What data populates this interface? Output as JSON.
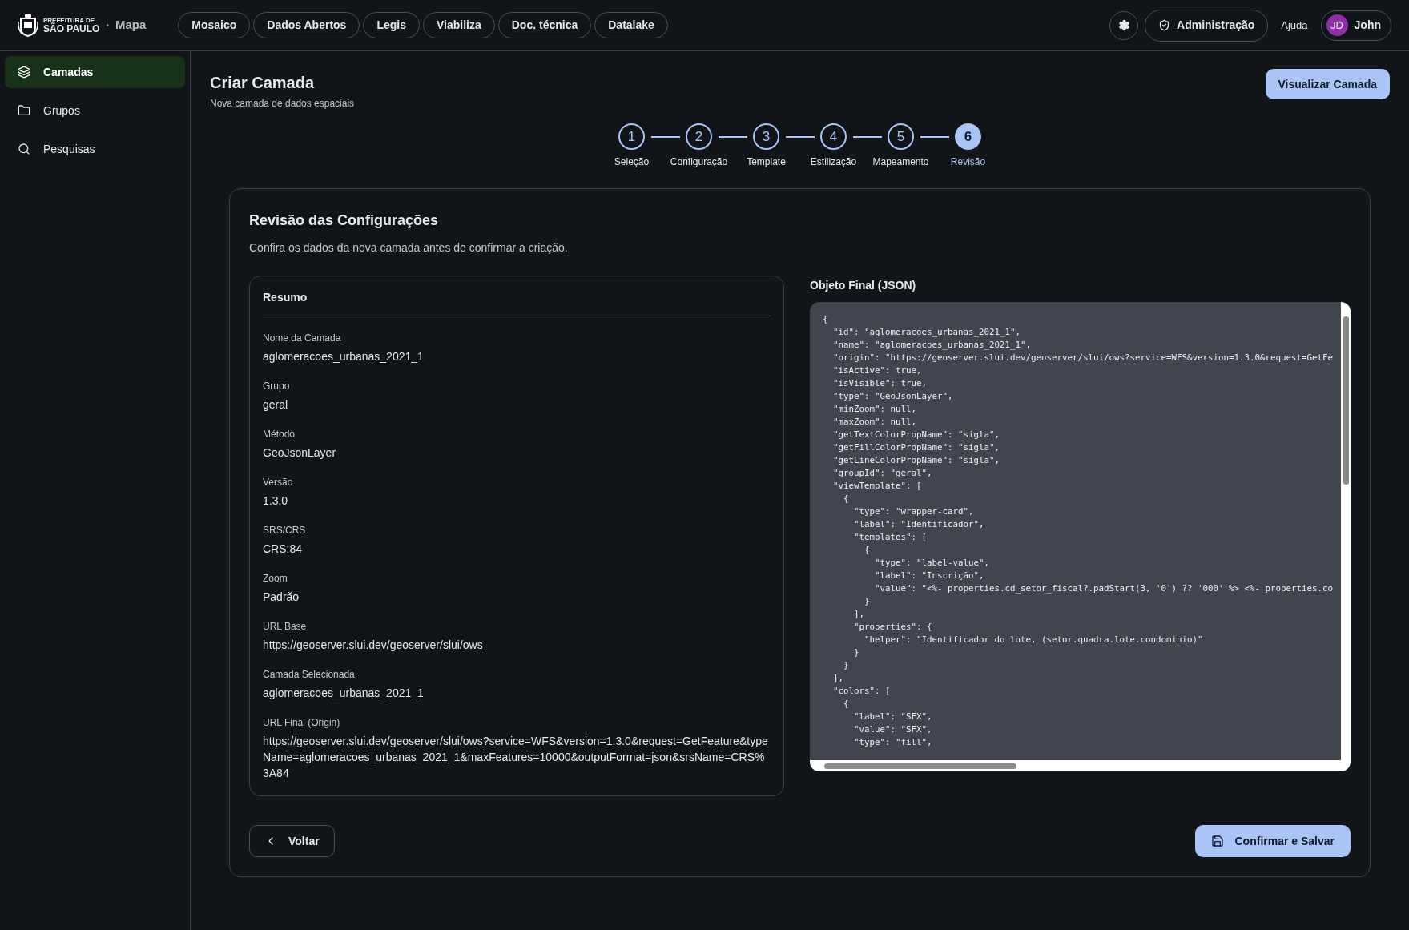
{
  "header": {
    "logo_line1": "PREFEITURA DE",
    "logo_line2": "SÃO PAULO",
    "separator": "•",
    "app_name": "Mapa",
    "nav": [
      "Mosaico",
      "Dados Abertos",
      "Legis",
      "Viabiliza",
      "Doc. técnica",
      "Datalake"
    ],
    "admin_button": "Administração",
    "help_link": "Ajuda",
    "user": {
      "initials": "JD",
      "name": "John"
    }
  },
  "sidebar": {
    "items": [
      {
        "label": "Camadas",
        "selected": true
      },
      {
        "label": "Grupos",
        "selected": false
      },
      {
        "label": "Pesquisas",
        "selected": false
      }
    ]
  },
  "page": {
    "title": "Criar Camada",
    "subtitle": "Nova camada de dados espaciais",
    "preview_button": "Visualizar Camada"
  },
  "steps": [
    {
      "number": "1",
      "label": "Seleção",
      "selected": false
    },
    {
      "number": "2",
      "label": "Configuração",
      "selected": false
    },
    {
      "number": "3",
      "label": "Template",
      "selected": false
    },
    {
      "number": "4",
      "label": "Estilização",
      "selected": false
    },
    {
      "number": "5",
      "label": "Mapeamento",
      "selected": false
    },
    {
      "number": "6",
      "label": "Revisão",
      "selected": true
    }
  ],
  "review": {
    "title": "Revisão das Configurações",
    "description": "Confira os dados da nova camada antes de confirmar a criação.",
    "summary": {
      "title": "Resumo",
      "fields": [
        {
          "label": "Nome da Camada",
          "value": "aglomeracoes_urbanas_2021_1"
        },
        {
          "label": "Grupo",
          "value": "geral"
        },
        {
          "label": "Método",
          "value": "GeoJsonLayer"
        },
        {
          "label": "Versão",
          "value": "1.3.0"
        },
        {
          "label": "SRS/CRS",
          "value": "CRS:84"
        },
        {
          "label": "Zoom",
          "value": "Padrão"
        },
        {
          "label": "URL Base",
          "value": "https://geoserver.slui.dev/geoserver/slui/ows"
        },
        {
          "label": "Camada Selecionada",
          "value": "aglomeracoes_urbanas_2021_1"
        },
        {
          "label": "URL Final (Origin)",
          "value": "https://geoserver.slui.dev/geoserver/slui/ows?service=WFS&version=1.3.0&request=GetFeature&typeName=aglomeracoes_urbanas_2021_1&maxFeatures=10000&outputFormat=json&srsName=CRS%3A84"
        }
      ]
    },
    "json_title": "Objeto Final (JSON)",
    "json_lines": [
      "{",
      "  \"id\": \"aglomeracoes_urbanas_2021_1\",",
      "  \"name\": \"aglomeracoes_urbanas_2021_1\",",
      "  \"origin\": \"https://geoserver.slui.dev/geoserver/slui/ows?service=WFS&version=1.3.0&request=GetFe",
      "  \"isActive\": true,",
      "  \"isVisible\": true,",
      "  \"type\": \"GeoJsonLayer\",",
      "  \"minZoom\": null,",
      "  \"maxZoom\": null,",
      "  \"getTextColorPropName\": \"sigla\",",
      "  \"getFillColorPropName\": \"sigla\",",
      "  \"getLineColorPropName\": \"sigla\",",
      "  \"groupId\": \"geral\",",
      "  \"viewTemplate\": [",
      "    {",
      "      \"type\": \"wrapper-card\",",
      "      \"label\": \"Identificador\",",
      "      \"templates\": [",
      "        {",
      "          \"type\": \"label-value\",",
      "          \"label\": \"Inscrição\",",
      "          \"value\": \"<%- properties.cd_setor_fiscal?.padStart(3, '0') ?? '000' %> <%- properties.co",
      "        }",
      "      ],",
      "      \"properties\": {",
      "        \"helper\": \"Identificador do lote, (setor.quadra.lote.condominio)\"",
      "      }",
      "    }",
      "  ],",
      "  \"colors\": [",
      "    {",
      "      \"label\": \"SFX\",",
      "      \"value\": \"SFX\",",
      "      \"type\": \"fill\","
    ],
    "back_button": "Voltar",
    "confirm_button": "Confirmar e Salvar"
  }
}
